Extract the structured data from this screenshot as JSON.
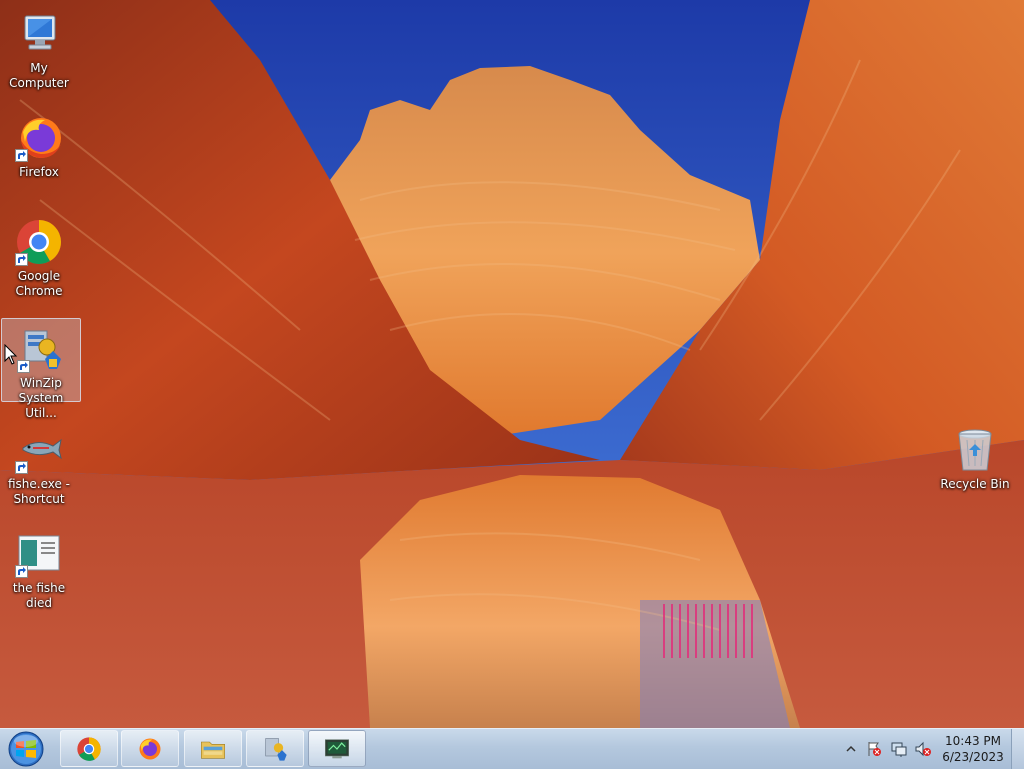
{
  "desktop": {
    "icons": [
      {
        "label": "My Computer",
        "icon": "my-computer-icon"
      },
      {
        "label": "Firefox",
        "icon": "firefox-icon"
      },
      {
        "label": "Google Chrome",
        "icon": "chrome-icon"
      },
      {
        "label": "WinZip System Util...",
        "icon": "winzip-icon",
        "selected": true
      },
      {
        "label": "fishe.exe - Shortcut",
        "icon": "fish-icon"
      },
      {
        "label": "the fishe died",
        "icon": "document-icon"
      },
      {
        "label": "Recycle Bin",
        "icon": "recycle-bin-icon"
      }
    ]
  },
  "taskbar": {
    "pinned": [
      {
        "name": "Google Chrome",
        "icon": "chrome-icon"
      },
      {
        "name": "Firefox",
        "icon": "firefox-icon"
      },
      {
        "name": "Windows Explorer",
        "icon": "folder-icon"
      },
      {
        "name": "WinZip System Utilities",
        "icon": "winzip-icon"
      },
      {
        "name": "fishe.exe",
        "icon": "monitor-icon",
        "active": true
      }
    ],
    "tray_icons": [
      "show-hidden-icons-arrow",
      "action-center-flag-icon",
      "network-icon",
      "volume-muted-icon"
    ],
    "clock": {
      "time": "10:43 PM",
      "date": "6/23/2023"
    }
  },
  "colors": {
    "taskbar": "#b4c8de",
    "sky": "#2f62d8",
    "rock": "#d8661f"
  }
}
